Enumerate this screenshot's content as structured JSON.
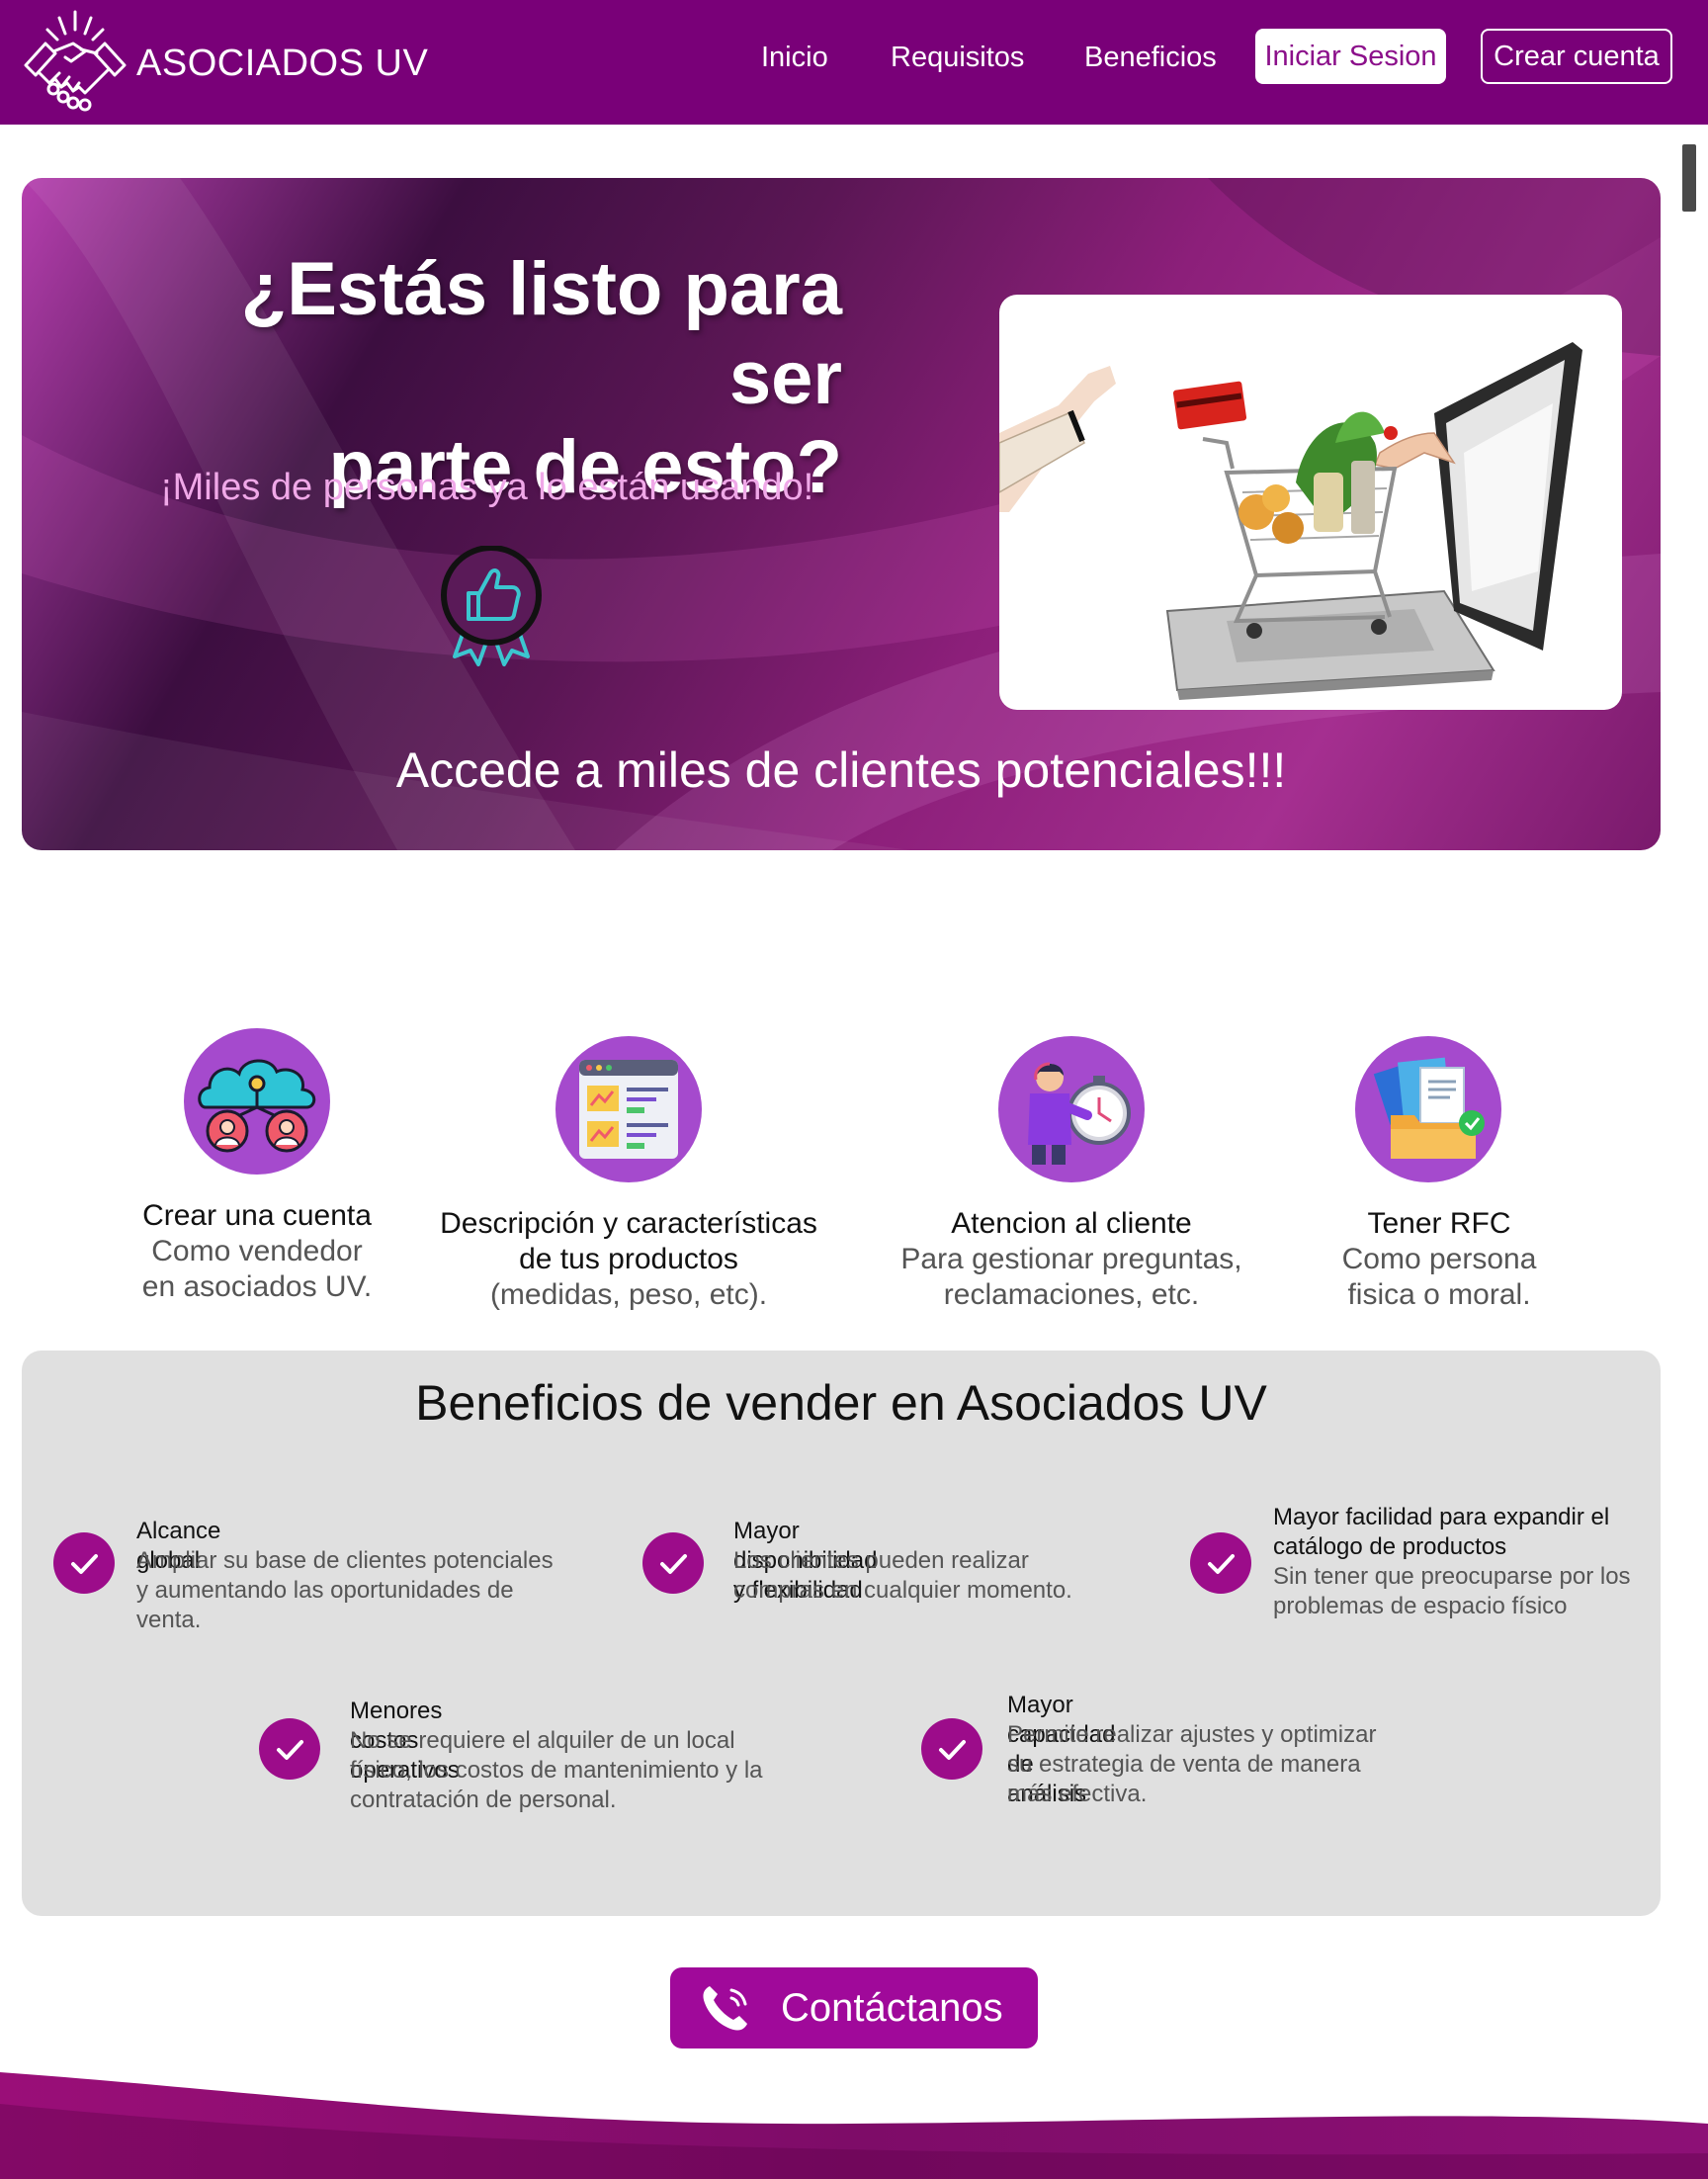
{
  "brand": {
    "name": "ASOCIADOS UV",
    "logo_icon": "handshake-icon"
  },
  "nav": {
    "items": [
      "Inicio",
      "Requisitos",
      "Beneficios"
    ],
    "login_label": "Iniciar Sesion",
    "register_label": "Crear cuenta"
  },
  "hero": {
    "title_line1": "¿Estás listo para ser",
    "title_line2": "parte de esto?",
    "subtitle": "¡Miles de personas ya lo están usando!",
    "badge_icon": "thumbs-up-award-icon",
    "image_icon": "laptop-shopping-cart-image",
    "cta": "Accede a miles de clientes potenciales!!!"
  },
  "requirements": [
    {
      "icon": "cloud-users-icon",
      "title": "Crear una cuenta",
      "desc1": "Como vendedor",
      "desc2": "en asociados UV."
    },
    {
      "icon": "product-description-icon",
      "title1": "Descripción y características",
      "title2": "de tus productos",
      "desc1": "(medidas, peso, etc)."
    },
    {
      "icon": "customer-support-icon",
      "title": "Atencion al cliente",
      "desc1": "Para gestionar preguntas,",
      "desc2": "reclamaciones, etc."
    },
    {
      "icon": "folder-documents-check-icon",
      "title": "Tener RFC",
      "desc1": "Como persona",
      "desc2": "fisica o moral."
    }
  ],
  "benefits": {
    "title": "Beneficios de vender en Asociados UV",
    "items": [
      {
        "title": "Alcance global",
        "desc": [
          "Ampliar su base de clientes potenciales",
          "y aumentando las oportunidades de",
          "venta."
        ]
      },
      {
        "title": "Mayor disponibilidad y flexibilidad",
        "desc": [
          "Los clientes pueden realizar",
          "compras en cualquier momento."
        ]
      },
      {
        "title": [
          "Mayor facilidad para expandir el",
          "catálogo de productos"
        ],
        "desc": [
          "Sin tener que preocuparse por los",
          "problemas de espacio físico"
        ]
      },
      {
        "title": "Menores costos operativos",
        "desc": [
          "No se requiere el alquiler de un local",
          "físico, los costos de mantenimiento y la",
          "contratación de personal."
        ]
      },
      {
        "title": "Mayor capacidad de análisis",
        "desc": [
          "Permite realizar ajustes y optimizar",
          "su estrategia de venta de manera",
          "más efectiva."
        ]
      }
    ]
  },
  "contact": {
    "label": "Contáctanos",
    "icon": "phone-icon"
  },
  "colors": {
    "primary": "#790078",
    "accent": "#a0099a",
    "check": "#9c0c8a",
    "icon_bg": "#a54acd",
    "panel": "#e0e0e0"
  }
}
